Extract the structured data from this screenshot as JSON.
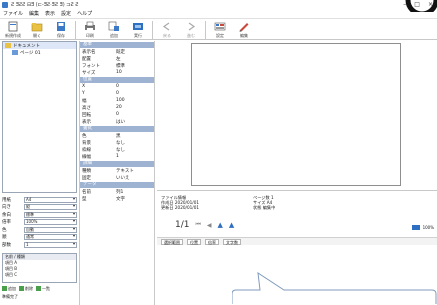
{
  "window": {
    "title": "Ƨ ƎƧƧ ⊟Ǝ (⊏-ƎƧ·ƎƧ Ǝ) ⊐Ƨ Ƨ",
    "controls": [
      "–",
      "□",
      "×"
    ]
  },
  "menu": [
    "ファイル",
    "編集",
    "表示",
    "設定",
    "ヘルプ"
  ],
  "toolbar": [
    {
      "label": "新規作成",
      "icon": "new-icon",
      "dim": false
    },
    {
      "label": "開く",
      "icon": "open-icon",
      "dim": false
    },
    {
      "label": "保存",
      "icon": "save-icon",
      "dim": false
    },
    {
      "label": "印刷",
      "icon": "print-icon",
      "dim": false
    },
    {
      "label": "追加",
      "icon": "add-icon",
      "dim": false
    },
    {
      "label": "実行",
      "icon": "run-icon",
      "dim": false
    },
    {
      "label": "戻る",
      "icon": "back-icon",
      "dim": true
    },
    {
      "label": "進む",
      "icon": "forward-icon",
      "dim": true
    },
    {
      "label": "設定",
      "icon": "settings-icon",
      "dim": false
    },
    {
      "label": "編集",
      "icon": "pen-icon",
      "dim": false
    }
  ],
  "tree": {
    "items": [
      {
        "label": "ドキュメント",
        "selected": true
      },
      {
        "label": "ページ 01",
        "selected": false
      }
    ]
  },
  "fields": [
    {
      "key": "用紙",
      "value": "A4"
    },
    {
      "key": "向き",
      "value": "縦"
    },
    {
      "key": "余白",
      "value": "標準"
    },
    {
      "key": "倍率",
      "value": "100%"
    },
    {
      "key": "色",
      "value": "自動"
    },
    {
      "key": "順",
      "value": "通常"
    },
    {
      "key": "部数",
      "value": "1"
    }
  ],
  "listbox": {
    "header": "名前 / 種類",
    "rows": [
      "項目 A",
      "項目 B",
      "項目 C"
    ]
  },
  "bottom": {
    "buttons": [
      "追加",
      "削除",
      "一覧"
    ],
    "text": "準備完了"
  },
  "properties": {
    "sections": [
      {
        "title": "基本",
        "rows": [
          {
            "name": "表示名",
            "value": "既定"
          },
          {
            "name": "配置",
            "value": "左"
          },
          {
            "name": "フォント",
            "value": "標準"
          },
          {
            "name": "サイズ",
            "value": "10"
          }
        ]
      },
      {
        "title": "位置",
        "rows": [
          {
            "name": "X",
            "value": "0"
          },
          {
            "name": "Y",
            "value": "0"
          },
          {
            "name": "幅",
            "value": "100"
          },
          {
            "name": "高さ",
            "value": "20"
          },
          {
            "name": "回転",
            "value": "0"
          },
          {
            "name": "表示",
            "value": "はい"
          }
        ]
      },
      {
        "title": "書式",
        "rows": [
          {
            "name": "色",
            "value": "黒"
          },
          {
            "name": "背景",
            "value": "なし"
          },
          {
            "name": "枠線",
            "value": "なし"
          },
          {
            "name": "線幅",
            "value": "1"
          }
        ]
      },
      {
        "title": "詳細",
        "rows": [
          {
            "name": "種類",
            "value": "テキスト"
          },
          {
            "name": "固定",
            "value": "いいえ"
          }
        ]
      },
      {
        "title": "データ",
        "rows": [
          {
            "name": "名前",
            "value": "列1"
          },
          {
            "name": "型",
            "value": "文字"
          }
        ]
      }
    ]
  },
  "info": {
    "left": [
      "ファイル情報",
      "作成日 2020/01/01",
      "更新日 2020/01/01"
    ],
    "right": [
      "ページ数 1",
      "サイズ A4",
      "状態 編集中"
    ]
  },
  "pager": {
    "current": "1/1"
  },
  "zoom": {
    "label": "100%"
  },
  "status": [
    "選択範囲",
    "位置",
    "倍率",
    "文字数"
  ],
  "colors": {
    "accent": "#2d6fc0",
    "sectionHeader": "#9eb3d2",
    "folder": "#e9c244"
  }
}
